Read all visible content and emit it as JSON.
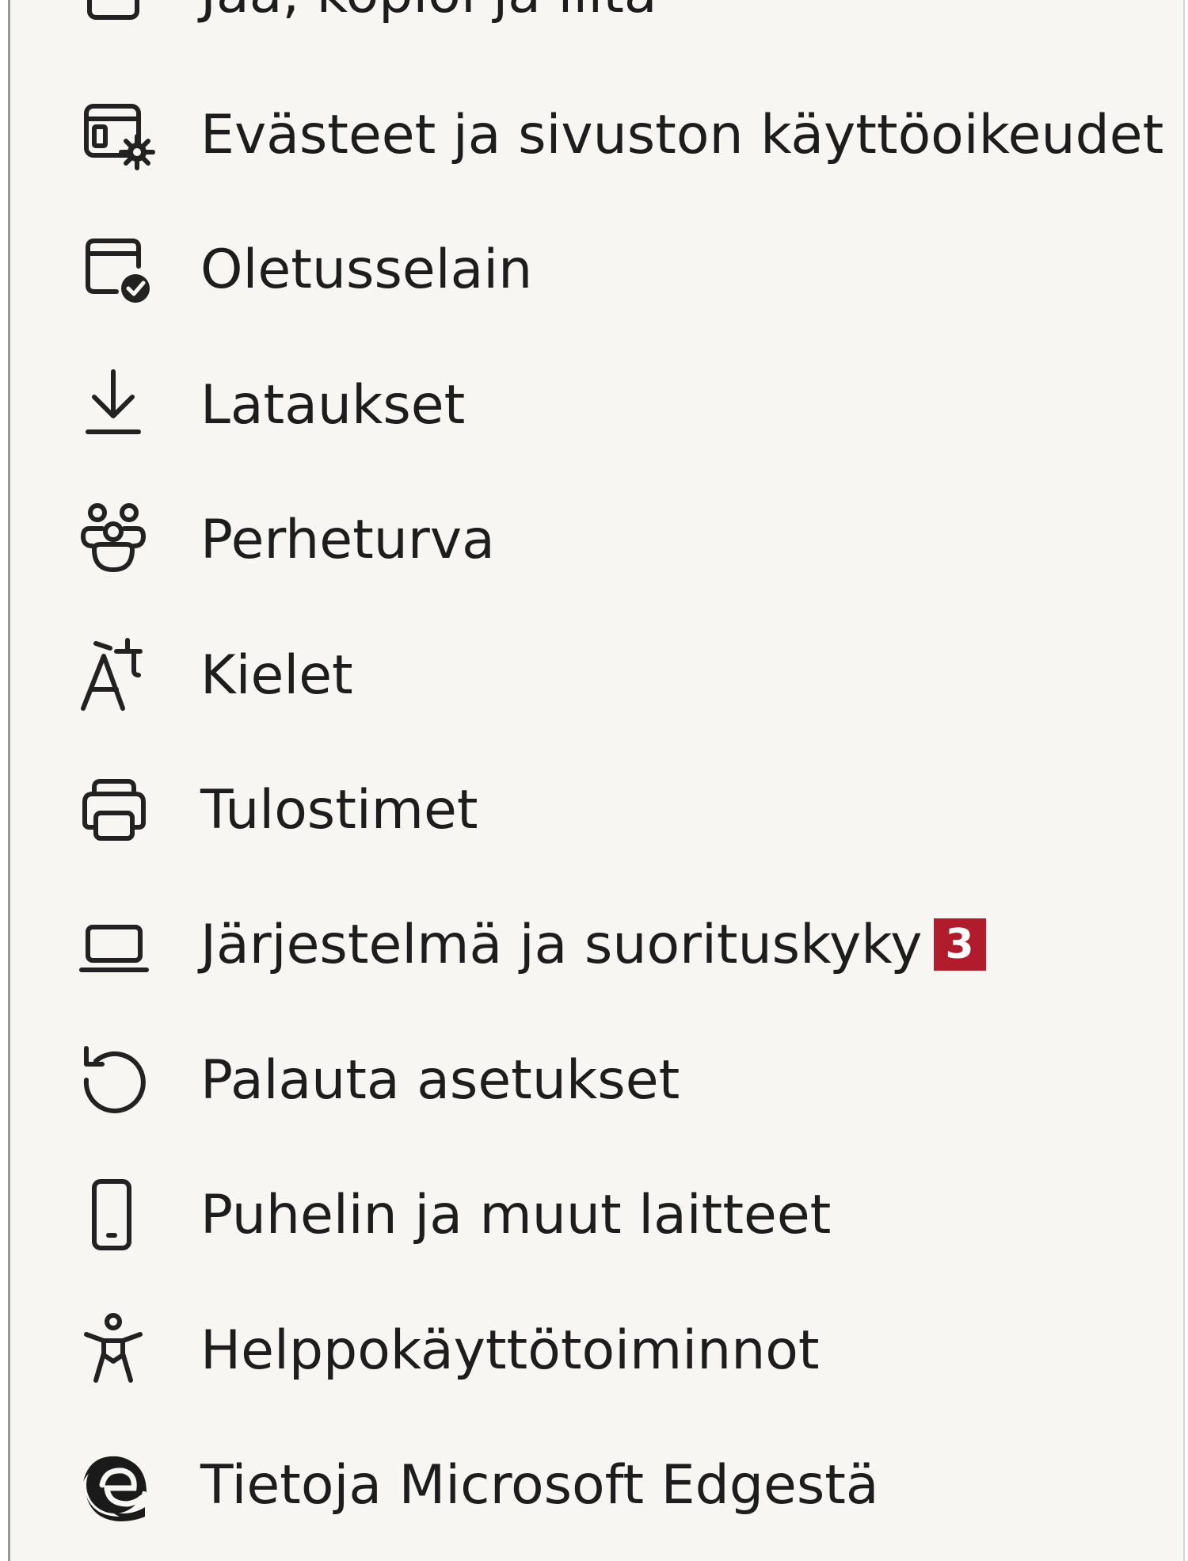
{
  "menu": {
    "items": [
      {
        "label": "Jaa, kopioi ja liitä",
        "icon": "share-icon"
      },
      {
        "label": "Evästeet ja sivuston käyttöoikeudet",
        "icon": "cookies-permissions-icon"
      },
      {
        "label": "Oletusselain",
        "icon": "default-browser-icon"
      },
      {
        "label": "Lataukset",
        "icon": "download-icon"
      },
      {
        "label": "Perheturva",
        "icon": "family-icon"
      },
      {
        "label": "Kielet",
        "icon": "languages-icon"
      },
      {
        "label": "Tulostimet",
        "icon": "printer-icon"
      },
      {
        "label": "Järjestelmä ja suorituskyky",
        "icon": "laptop-icon",
        "badge": "3"
      },
      {
        "label": "Palauta asetukset",
        "icon": "reset-icon"
      },
      {
        "label": "Puhelin ja muut laitteet",
        "icon": "phone-icon"
      },
      {
        "label": "Helppokäyttötoiminnot",
        "icon": "accessibility-icon"
      },
      {
        "label": "Tietoja Microsoft Edgestä",
        "icon": "edge-logo-icon"
      }
    ]
  },
  "colors": {
    "panel_background": "#f7f6f3",
    "text": "#1d1d1d",
    "badge_background": "#b01c2b",
    "badge_text": "#ffffff"
  }
}
